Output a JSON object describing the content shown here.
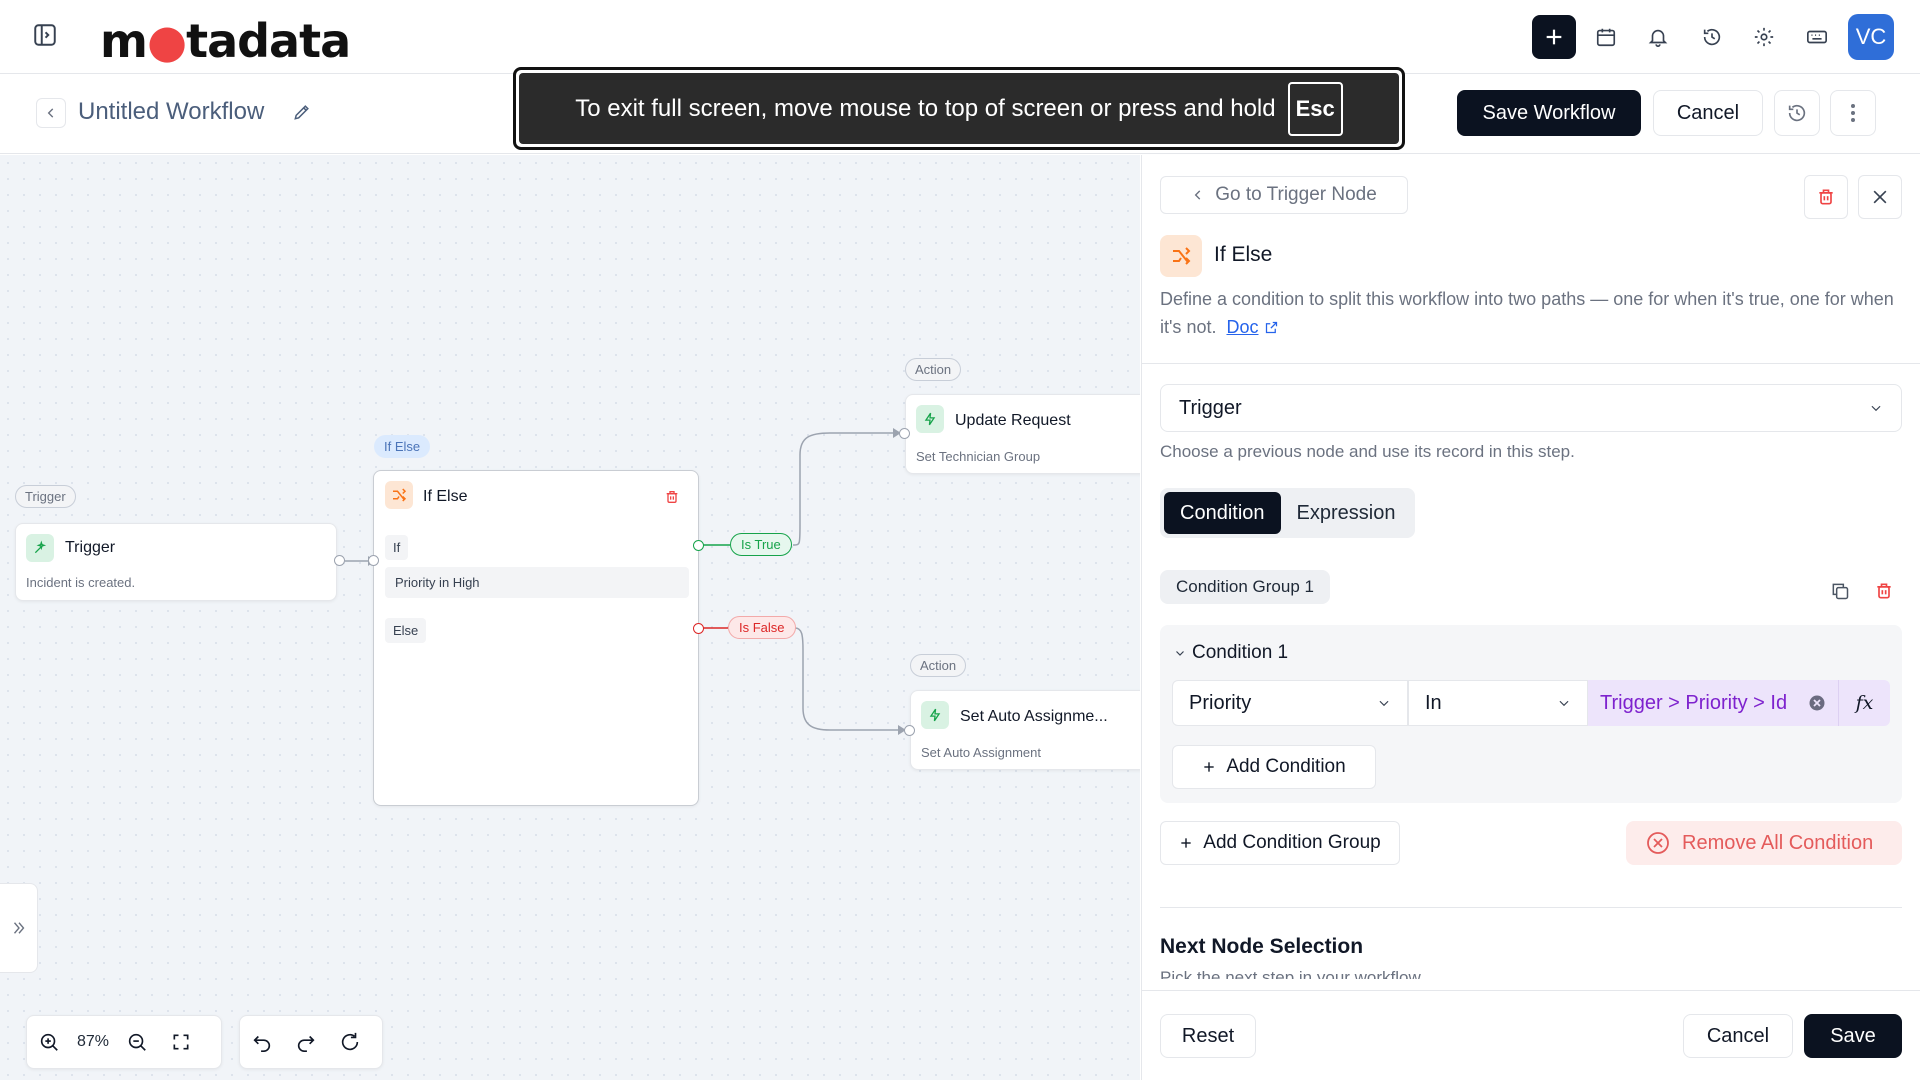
{
  "app": {
    "logo_pre": "m",
    "logo_dot": "●",
    "logo_post": "tadata",
    "avatar_initials": "VC"
  },
  "toast": {
    "message": "To exit full screen, move mouse to top of screen or press and hold",
    "key": "Esc"
  },
  "workflow": {
    "title": "Untitled Workflow",
    "save_label": "Save Workflow",
    "cancel_label": "Cancel"
  },
  "canvas": {
    "trigger_tag": "Trigger",
    "trigger_title": "Trigger",
    "trigger_sub": "Incident is created.",
    "ifelse_tag": "If Else",
    "ifelse_title": "If Else",
    "if_label": "If",
    "if_condition": "Priority in High",
    "else_label": "Else",
    "true_label": "Is True",
    "false_label": "Is False",
    "action1_tag": "Action",
    "action1_title": "Update Request",
    "action1_sub": "Set Technician Group",
    "action2_tag": "Action",
    "action2_title": "Set Auto Assignme...",
    "action2_sub": "Set Auto Assignment",
    "zoom": "87%"
  },
  "panel": {
    "go_to_trigger": "Go to Trigger Node",
    "node_title": "If Else",
    "description": "Define a condition to split this workflow into two paths — one for when it's true, one for when it's not.",
    "doc_link": "Doc",
    "source_select": "Trigger",
    "source_help": "Choose a previous node and use its record in this step.",
    "tab_condition": "Condition",
    "tab_expression": "Expression",
    "group_label": "Condition Group 1",
    "condition_label": "Condition 1",
    "field_value": "Priority",
    "operator_value": "In",
    "value_text": "Trigger > Priority > Id",
    "fx_label": "fx",
    "add_condition": "Add Condition",
    "add_group": "Add Condition Group",
    "remove_all": "Remove All Condition",
    "next_title": "Next Node Selection",
    "next_help": "Pick the next step in your workflow.",
    "reset_label": "Reset",
    "cancel_label": "Cancel",
    "save_label": "Save"
  },
  "colors": {
    "primary_dark": "#0b1220",
    "accent_blue": "#2f6ed8",
    "true_green": "#16a34a",
    "false_red": "#dc2626",
    "value_purple": "#7e22ce"
  }
}
